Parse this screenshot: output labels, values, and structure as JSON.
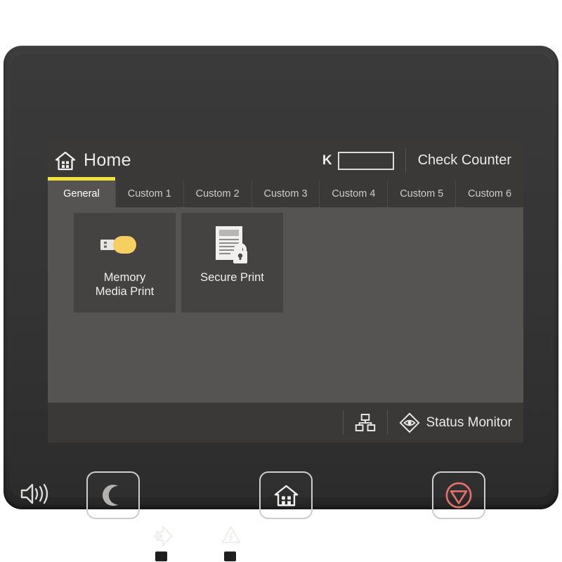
{
  "screen": {
    "header": {
      "home_icon": "home-icon",
      "title": "Home",
      "toner": {
        "label": "K",
        "icon": "toner-level-bar",
        "level_percent": 0
      },
      "check_counter_label": "Check Counter"
    },
    "tabs": [
      {
        "label": "General",
        "active": true
      },
      {
        "label": "Custom 1",
        "active": false
      },
      {
        "label": "Custom 2",
        "active": false
      },
      {
        "label": "Custom 3",
        "active": false
      },
      {
        "label": "Custom 4",
        "active": false
      },
      {
        "label": "Custom 5",
        "active": false
      },
      {
        "label": "Custom 6",
        "active": false
      }
    ],
    "tiles": [
      {
        "label_line1": "Memory",
        "label_line2": "Media Print",
        "icon": "usb-drive-icon"
      },
      {
        "label_line1": "Secure Print",
        "label_line2": "",
        "icon": "document-lock-icon"
      }
    ],
    "status_bar": {
      "network_icon": "network-icon",
      "status_monitor_icon": "status-monitor-eye-icon",
      "status_monitor_label": "Status Monitor"
    }
  },
  "hardware": {
    "speaker_icon": "speaker-volume-icon",
    "buttons": [
      {
        "name": "sleep",
        "icon": "moon-icon"
      },
      {
        "name": "home",
        "icon": "house-icon"
      },
      {
        "name": "stop",
        "icon": "stop-icon"
      }
    ],
    "indicators": [
      {
        "name": "data",
        "icon": "data-arrow-icon"
      },
      {
        "name": "error",
        "icon": "warning-triangle-icon"
      }
    ]
  },
  "colors": {
    "accent_yellow": "#f2e33c",
    "stop_red": "#e2716a",
    "usb_yellow": "#f6cf61",
    "screen_bg": "#3d3c3b",
    "panel_bg": "#565453",
    "tile_bg": "#444342"
  }
}
